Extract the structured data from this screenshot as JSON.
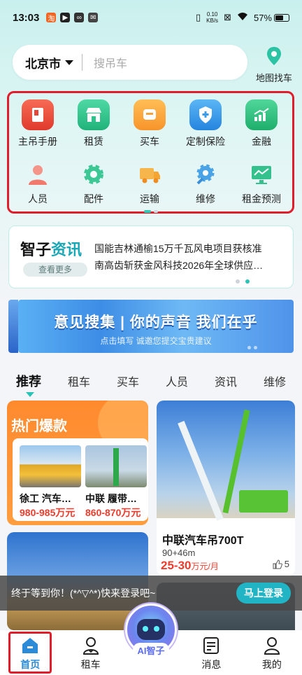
{
  "status_bar": {
    "time": "13:03",
    "speed_top": "0.10",
    "speed_bottom": "KB/s",
    "battery": "57%"
  },
  "search": {
    "city": "北京市",
    "placeholder": "搜吊车",
    "map_label": "地图找车"
  },
  "grid": {
    "items": [
      {
        "label": "主吊手册",
        "icon": "book-icon",
        "color": "#ea4a3a"
      },
      {
        "label": "租赁",
        "icon": "store-icon",
        "color": "#2bc48a"
      },
      {
        "label": "买车",
        "icon": "car-icon",
        "color": "#f6a23a"
      },
      {
        "label": "定制保险",
        "icon": "shield-icon",
        "color": "#3a9be8"
      },
      {
        "label": "金融",
        "icon": "chart-icon",
        "color": "#2cbe7e"
      },
      {
        "label": "人员",
        "icon": "people-icon",
        "color": "#f0857a"
      },
      {
        "label": "配件",
        "icon": "gear-icon",
        "color": "#39c48e"
      },
      {
        "label": "运输",
        "icon": "truck-icon",
        "color": "#f4b04a"
      },
      {
        "label": "维修",
        "icon": "wrench-gear-icon",
        "color": "#4aa3e6"
      },
      {
        "label": "租金预测",
        "icon": "monitor-chart-icon",
        "color": "#32be8c"
      }
    ]
  },
  "news": {
    "logo_a": "智子",
    "logo_b": "资讯",
    "more": "查看更多",
    "lines": [
      "国能吉林通榆15万千瓦风电项目获核准",
      "南高齿斩获金风科技2026年全球供应…"
    ]
  },
  "banner": {
    "title": "意见搜集 | 你的声音 我们在乎",
    "subtitle": "点击填写 诚邀您提交宝贵建议"
  },
  "tabs": [
    "推荐",
    "租车",
    "买车",
    "人员",
    "资讯",
    "维修"
  ],
  "hot": {
    "title": "热门爆款",
    "items": [
      {
        "name": "徐工 汽车…",
        "price": "980-985万元"
      },
      {
        "name": "中联 履带…",
        "price": "860-870万元"
      }
    ]
  },
  "crane_card": {
    "name": "中联汽车吊700T",
    "spec": "90+46m",
    "price": "25-30",
    "unit": "万元/月",
    "likes": "5"
  },
  "toast": {
    "text": "终于等到你！(*^▽^*)快来登录吧~",
    "button": "马上登录"
  },
  "nav": {
    "home": "首页",
    "rent": "租车",
    "ai": "AI智子",
    "messages": "消息",
    "mine": "我的"
  }
}
